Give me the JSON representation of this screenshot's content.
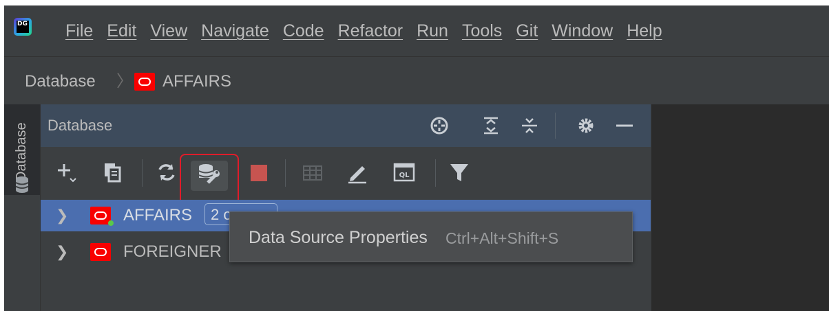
{
  "menubar": {
    "app_icon_text": "DG",
    "items": [
      "File",
      "Edit",
      "View",
      "Navigate",
      "Code",
      "Refactor",
      "Run",
      "Tools",
      "Git",
      "Window",
      "Help"
    ]
  },
  "navbar": {
    "crumbs": [
      "Database",
      "AFFAIRS"
    ],
    "crumb_icons": [
      "oracle-icon"
    ]
  },
  "sidestripe": {
    "tab_label": "Database",
    "icon": "database-icon"
  },
  "toolwindow": {
    "title": "Database",
    "header_icons": [
      "crosshair-icon",
      "expand-all-icon",
      "collapse-all-icon",
      "gear-icon",
      "minimize-icon"
    ],
    "toolbar_icons": [
      "add-icon",
      "copy-icon",
      "refresh-icon",
      "data-source-properties-icon",
      "stop-icon",
      "table-icon",
      "edit-icon",
      "query-console-icon",
      "filter-icon"
    ],
    "highlighted_button": "data-source-properties-icon"
  },
  "tree": [
    {
      "label": "AFFAIRS",
      "badge": "2 o",
      "selected": true,
      "icon": "oracle-icon",
      "connected": true
    },
    {
      "label": "FOREIGNER",
      "selected": false,
      "icon": "oracle-icon",
      "connected": false
    }
  ],
  "tooltip": {
    "text": "Data Source Properties",
    "shortcut": "Ctrl+Alt+Shift+S"
  },
  "colors": {
    "background": "#3c3f41",
    "header": "#3d4b5c",
    "selection": "#4b6eaf",
    "oracle_red": "#f80000",
    "highlight_border": "#e01c2a",
    "editor": "#2b2b2b",
    "connected_dot": "#59c84a"
  }
}
